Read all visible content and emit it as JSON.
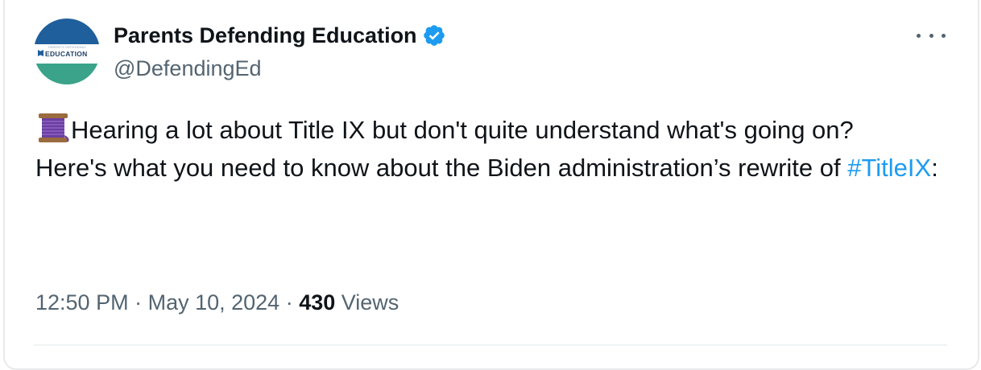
{
  "author": {
    "display_name": "Parents Defending Education",
    "handle": "@DefendingEd",
    "verified_icon": "verified-badge-icon",
    "avatar": {
      "brand_small": "PARENTS DEFENDING",
      "brand_big": "EDUCATION"
    }
  },
  "more_icon": "more-options-icon",
  "tweet": {
    "emoji_icon": "thread-spool-icon",
    "line1": "Hearing a lot about Title IX but don't quite understand what's going on?",
    "line2": "Here's what you need to know about the Biden administration’s rewrite of ",
    "hashtag": "#TitleIX",
    "suffix": ":"
  },
  "meta": {
    "time": "12:50 PM",
    "sep1": " · ",
    "date": "May 10, 2024",
    "sep2": " · ",
    "views_count": "430",
    "views_label": " Views"
  },
  "colors": {
    "link": "#1d9bf0",
    "muted": "#536471",
    "text": "#0f1419"
  }
}
